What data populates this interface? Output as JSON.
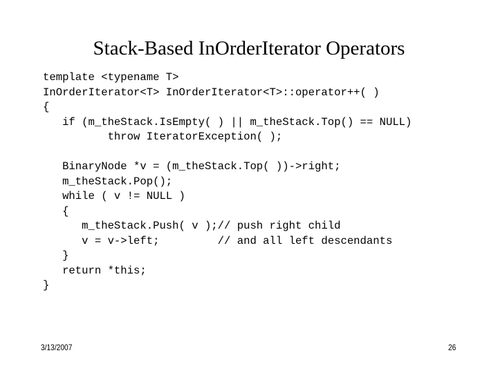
{
  "slide": {
    "title": "Stack-Based InOrderIterator Operators",
    "code_lines": [
      "template <typename T>",
      "InOrderIterator<T> InOrderIterator<T>::operator++( )",
      "{",
      "   if (m_theStack.IsEmpty( ) || m_theStack.Top() == NULL)",
      "          throw IteratorException( );",
      "",
      "   BinaryNode *v = (m_theStack.Top( ))->right;",
      "   m_theStack.Pop();",
      "   while ( v != NULL )",
      "   {",
      "      m_theStack.Push( v );// push right child",
      "      v = v->left;         // and all left descendants",
      "   }",
      "   return *this;",
      "}"
    ],
    "footer": {
      "date": "3/13/2007",
      "page_number": "26"
    }
  }
}
